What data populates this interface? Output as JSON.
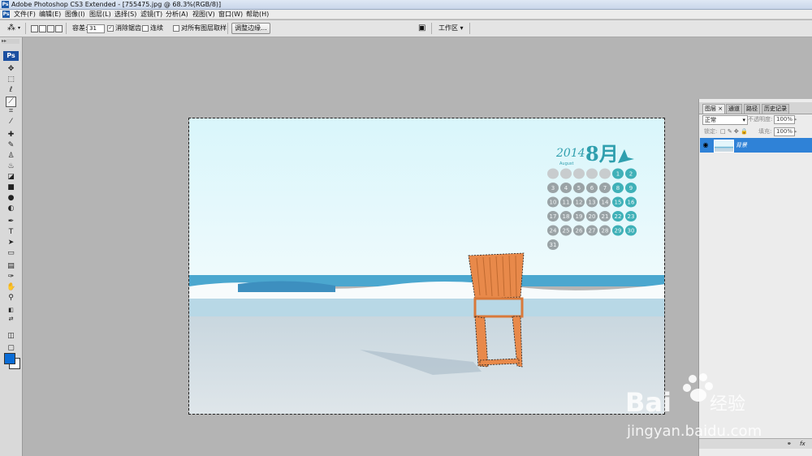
{
  "window": {
    "title": "Adobe Photoshop CS3 Extended - [755475.jpg @ 68.3%(RGB/8)]",
    "app_icon": "Ps"
  },
  "menubar": {
    "icon": "Ps",
    "items": [
      "文件(F)",
      "编辑(E)",
      "图像(I)",
      "图层(L)",
      "选择(S)",
      "滤镜(T)",
      "分析(A)",
      "视图(V)",
      "窗口(W)",
      "帮助(H)"
    ]
  },
  "options": {
    "tolerance_label": "容差:",
    "tolerance_value": "31",
    "antialias_label": "消除锯齿",
    "antialias_checked": true,
    "contiguous_label": "连续",
    "contiguous_checked": false,
    "sample_all_label": "对所有图层取样",
    "sample_all_checked": false,
    "refine_edge_label": "调整边缘...",
    "workspace_label": "工作区"
  },
  "toolbox": {
    "logo": "Ps",
    "active_tool": "magic-wand-tool",
    "foreground_color": "#0a6cd6",
    "background_color": "#ffffff"
  },
  "layers_panel": {
    "tabs": [
      "图层",
      "通道",
      "路径",
      "历史记录"
    ],
    "tab_close": "×",
    "blend_mode": "正常",
    "opacity_label": "不透明度:",
    "opacity_value": "100%",
    "lock_label": "锁定:",
    "fill_label": "填充:",
    "fill_value": "100%",
    "layers": [
      {
        "name": "背景",
        "visible": true,
        "selected": true
      }
    ],
    "footer_links": "fx"
  },
  "canvas": {
    "calendar_year": "2014",
    "calendar_month": "8月",
    "calendar_sub": "August",
    "days": [
      "1",
      "2",
      "3",
      "4",
      "5",
      "6",
      "7",
      "8",
      "9",
      "10",
      "11",
      "12",
      "13",
      "14",
      "15",
      "16",
      "17",
      "18",
      "19",
      "20",
      "21",
      "22",
      "23",
      "24",
      "25",
      "26",
      "27",
      "28",
      "29",
      "30",
      "31"
    ]
  },
  "watermark": {
    "brand": "Bai",
    "brand_cn": "经验",
    "url": "jingyan.baidu.com"
  },
  "colors": {
    "selection_accent": "#2f82d7",
    "sky": "#e6f8fb",
    "sea": "#4aa8d0",
    "chair": "#e8894a"
  }
}
